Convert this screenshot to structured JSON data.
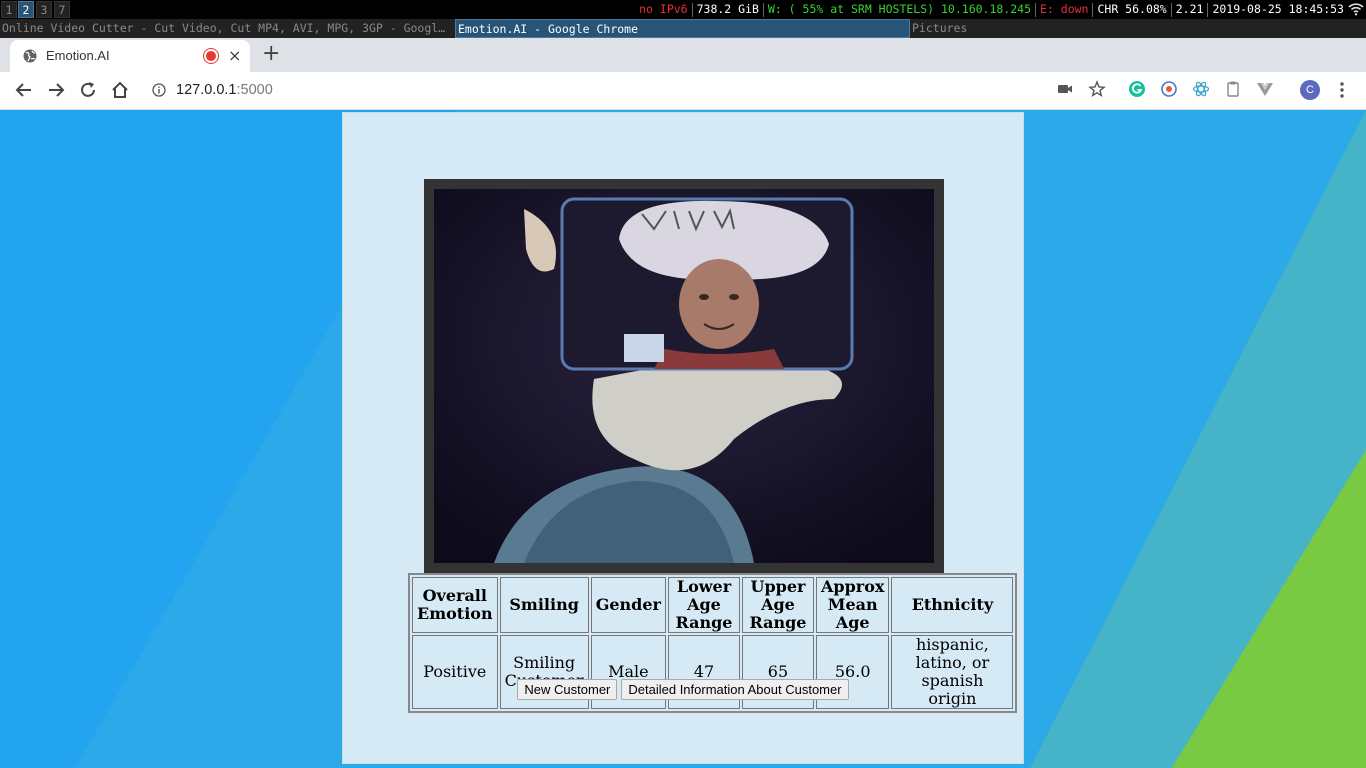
{
  "statusbar": {
    "workspaces": [
      "1",
      "2",
      "3",
      "7"
    ],
    "active_workspace": "2",
    "ipv6": "no IPv6",
    "disk": "738.2 GiB",
    "wifi": "W: ( 55% at SRM HOSTELS) 10.160.18.245",
    "ethernet": "E: down",
    "battery": "CHR 56.08%",
    "load": "2.21",
    "datetime": "2019-08-25 18:45:53"
  },
  "window_titles": [
    "Online Video Cutter - Cut Video, Cut MP4, AVI, MPG, 3GP - Googl…",
    "Emotion.AI - Google Chrome",
    "Pictures"
  ],
  "browser": {
    "tab_title": "Emotion.AI",
    "tab_close": "×",
    "new_tab": "+",
    "url_host": "127.0.0.1",
    "url_port": ":5000",
    "profile_initial": "C"
  },
  "results": {
    "headers": [
      "Overall Emotion",
      "Smiling",
      "Gender",
      "Lower Age Range",
      "Upper Age Range",
      "Approx Mean Age",
      "Ethnicity"
    ],
    "row": [
      "Positive",
      "Smiling Customer",
      "Male",
      "47",
      "65",
      "56.0",
      "hispanic, latino, or spanish origin"
    ]
  },
  "buttons": {
    "new_customer": "New Customer",
    "details": "Detailed Information About Customer"
  },
  "colors": {
    "page_bg": "#22a4f0",
    "card_bg": "#d6eaf6",
    "accent_green": "#7ac943",
    "i3_active": "#285577"
  }
}
